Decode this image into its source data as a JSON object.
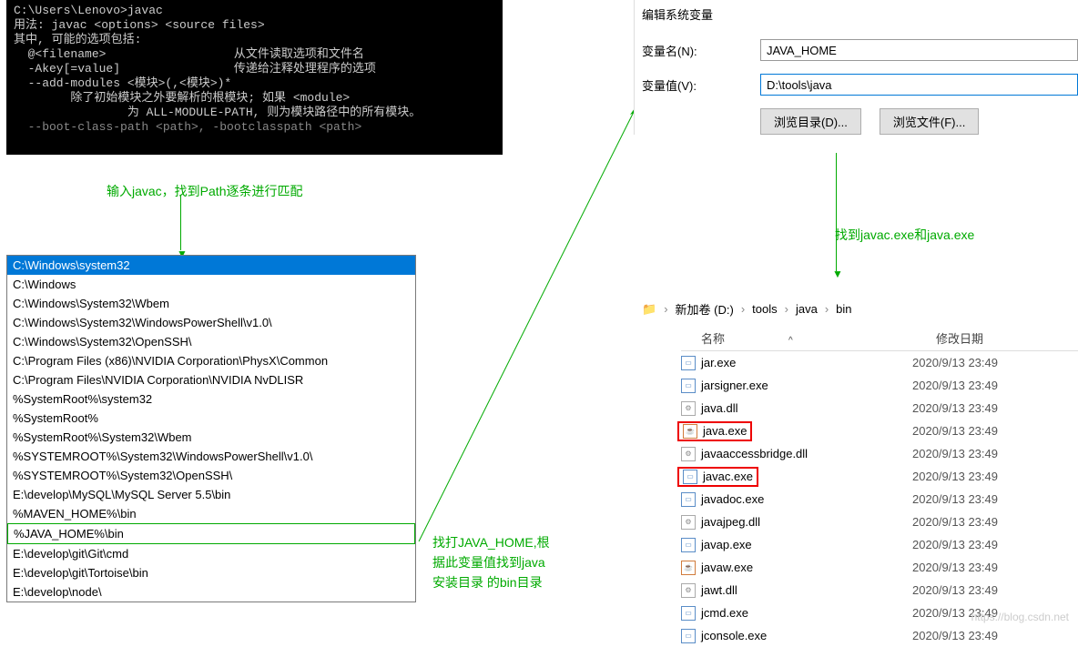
{
  "terminal": {
    "prompt": "C:\\Users\\Lenovo>",
    "cmd": "javac",
    "lines": [
      "用法: javac <options> <source files>",
      "其中, 可能的选项包括:",
      "  @<filename>                  从文件读取选项和文件名",
      "  -Akey[=value]                传递给注释处理程序的选项",
      "  --add-modules <模块>(,<模块>)*",
      "        除了初始模块之外要解析的根模块; 如果 <module>",
      "                为 ALL-MODULE-PATH, 则为模块路径中的所有模块。",
      "  --boot-class-path <path>, -bootclasspath <path>"
    ]
  },
  "annotations": {
    "a1": "输入javac，找到Path逐条进行匹配",
    "a2_l1": "找打JAVA_HOME,根",
    "a2_l2": "据此变量值找到java",
    "a2_l3": "安装目录 的bin目录",
    "a3": "找到javac.exe和java.exe"
  },
  "paths": [
    {
      "text": "C:\\Windows\\system32",
      "selected": true
    },
    {
      "text": "C:\\Windows"
    },
    {
      "text": "C:\\Windows\\System32\\Wbem"
    },
    {
      "text": "C:\\Windows\\System32\\WindowsPowerShell\\v1.0\\"
    },
    {
      "text": "C:\\Windows\\System32\\OpenSSH\\"
    },
    {
      "text": "C:\\Program Files (x86)\\NVIDIA Corporation\\PhysX\\Common"
    },
    {
      "text": "C:\\Program Files\\NVIDIA Corporation\\NVIDIA NvDLISR"
    },
    {
      "text": "%SystemRoot%\\system32"
    },
    {
      "text": "%SystemRoot%"
    },
    {
      "text": "%SystemRoot%\\System32\\Wbem"
    },
    {
      "text": "%SYSTEMROOT%\\System32\\WindowsPowerShell\\v1.0\\"
    },
    {
      "text": "%SYSTEMROOT%\\System32\\OpenSSH\\"
    },
    {
      "text": "E:\\develop\\MySQL\\MySQL Server 5.5\\bin"
    },
    {
      "text": "%MAVEN_HOME%\\bin"
    },
    {
      "text": "%JAVA_HOME%\\bin",
      "highlighted": true
    },
    {
      "text": "E:\\develop\\git\\Git\\cmd"
    },
    {
      "text": "E:\\develop\\git\\Tortoise\\bin"
    },
    {
      "text": "E:\\develop\\node\\"
    }
  ],
  "envDialog": {
    "title": "编辑系统变量",
    "nameLabel": "变量名(N):",
    "nameValue": "JAVA_HOME",
    "valueLabel": "变量值(V):",
    "valueValue": "D:\\tools\\java",
    "browseDir": "浏览目录(D)...",
    "browseFile": "浏览文件(F)..."
  },
  "breadcrumb": {
    "drive_icon": "📾",
    "drive": "新加卷 (D:)",
    "p1": "tools",
    "p2": "java",
    "p3": "bin"
  },
  "explorer": {
    "colName": "名称",
    "colDate": "修改日期",
    "files": [
      {
        "name": "jar.exe",
        "date": "2020/9/13 23:49",
        "type": "exe"
      },
      {
        "name": "jarsigner.exe",
        "date": "2020/9/13 23:49",
        "type": "exe"
      },
      {
        "name": "java.dll",
        "date": "2020/9/13 23:49",
        "type": "dll"
      },
      {
        "name": "java.exe",
        "date": "2020/9/13 23:49",
        "type": "java",
        "red": true
      },
      {
        "name": "javaaccessbridge.dll",
        "date": "2020/9/13 23:49",
        "type": "dll"
      },
      {
        "name": "javac.exe",
        "date": "2020/9/13 23:49",
        "type": "exe",
        "red": true
      },
      {
        "name": "javadoc.exe",
        "date": "2020/9/13 23:49",
        "type": "exe"
      },
      {
        "name": "javajpeg.dll",
        "date": "2020/9/13 23:49",
        "type": "dll"
      },
      {
        "name": "javap.exe",
        "date": "2020/9/13 23:49",
        "type": "exe"
      },
      {
        "name": "javaw.exe",
        "date": "2020/9/13 23:49",
        "type": "java"
      },
      {
        "name": "jawt.dll",
        "date": "2020/9/13 23:49",
        "type": "dll"
      },
      {
        "name": "jcmd.exe",
        "date": "2020/9/13 23:49",
        "type": "exe"
      },
      {
        "name": "jconsole.exe",
        "date": "2020/9/13 23:49",
        "type": "exe"
      }
    ]
  },
  "watermark": "https://blog.csdn.net"
}
